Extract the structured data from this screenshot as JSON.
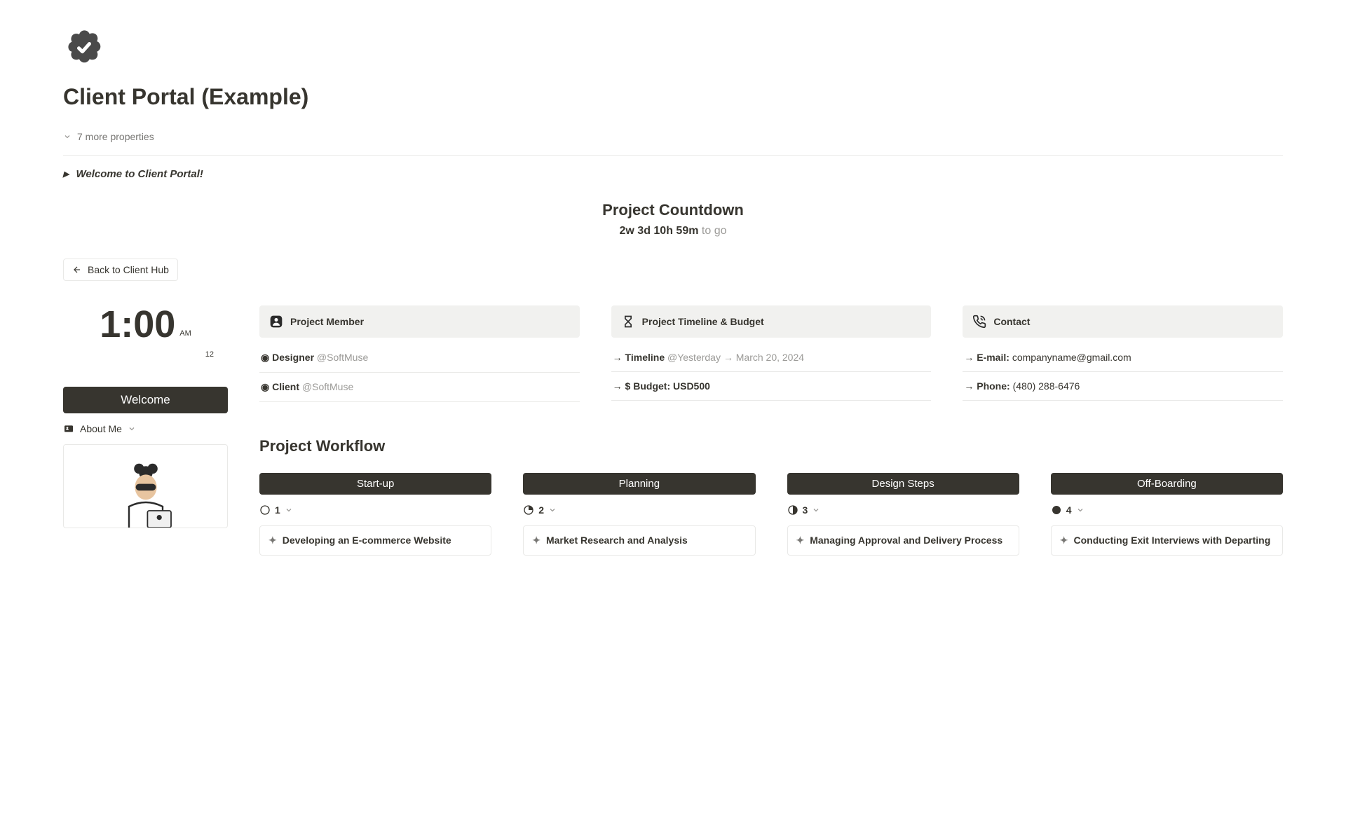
{
  "page": {
    "title": "Client Portal (Example)",
    "more_properties": "7 more properties",
    "welcome_toggle": "Welcome to Client Portal!"
  },
  "countdown": {
    "title": "Project Countdown",
    "time": "2w 3d 10h 59m",
    "suffix": " to go"
  },
  "back_button": "Back to Client Hub",
  "clock": {
    "time": "1:00",
    "ampm": "AM",
    "date": "12"
  },
  "sidebar": {
    "welcome": "Welcome",
    "about_me": "About Me"
  },
  "cards": {
    "member": {
      "title": "Project Member",
      "designer_label": "◉ Designer",
      "designer_user": "@SoftMuse",
      "client_label": "◉ Client",
      "client_user": "@SoftMuse"
    },
    "timeline": {
      "title": "Project Timeline & Budget",
      "timeline_label": "→ Timeline",
      "timeline_start": "@Yesterday",
      "timeline_arrow": " → ",
      "timeline_end": "March 20, 2024",
      "budget_label": "→ $ Budget: USD500"
    },
    "contact": {
      "title": "Contact",
      "email_label": "→ E-mail: ",
      "email_value": "companyname@gmail.com",
      "phone_label": "→ Phone: ",
      "phone_value": "(480) 288-6476"
    }
  },
  "workflow": {
    "title": "Project Workflow",
    "columns": [
      {
        "name": "Start-up",
        "count": "1",
        "card": "Developing an E-commerce Website"
      },
      {
        "name": "Planning",
        "count": "2",
        "card": "Market Research and Analysis"
      },
      {
        "name": "Design Steps",
        "count": "3",
        "card": "Managing Approval and Delivery Process"
      },
      {
        "name": "Off-Boarding",
        "count": "4",
        "card": "Conducting Exit Interviews with Departing"
      }
    ]
  }
}
